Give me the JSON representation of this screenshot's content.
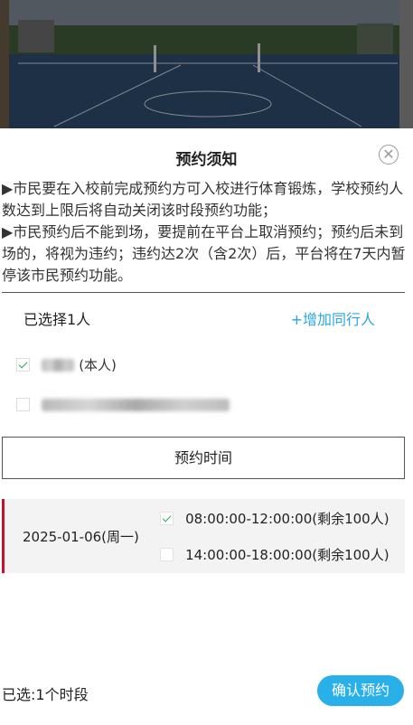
{
  "header": {
    "title": "预约须知",
    "close_icon": "close-circle-icon"
  },
  "notice": {
    "rule1": "▶市民要在入校前完成预约方可入校进行体育锻炼，学校预约人数达到上限后将自动关闭该时段预约功能；",
    "rule2": "▶市民预约后不能到场，要提前在平台上取消预约；预约后未到场的，将视为违约；违约达2次（含2次）后，平台将在7天内暂停该市民预约功能。"
  },
  "companions": {
    "selected_count": "已选择1人",
    "add_label": "+增加同行人",
    "people": [
      {
        "label": "(本人)",
        "checked": true
      },
      {
        "label": "",
        "checked": false
      }
    ]
  },
  "booking": {
    "time_button": "预约时间",
    "date": "2025-01-06(周一)",
    "slots": [
      {
        "label": "08:00:00-12:00:00(剩余100人)",
        "checked": true
      },
      {
        "label": "14:00:00-18:00:00(剩余100人)",
        "checked": false
      }
    ]
  },
  "footer": {
    "selected_summary": "已选:1个时段",
    "confirm_label": "确认预约"
  },
  "colors": {
    "accent": "#29b0e8",
    "check": "#2aa55a",
    "date_bar": "#c8102e"
  }
}
